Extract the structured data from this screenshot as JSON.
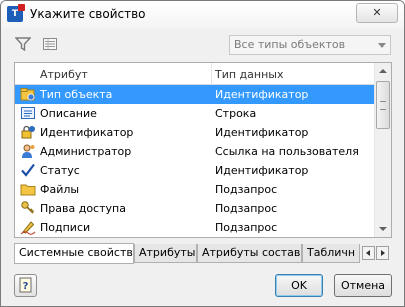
{
  "window": {
    "title": "Укажите свойство",
    "close_label": "✕"
  },
  "toolbar": {
    "filter_icon": "funnel-icon",
    "list_icon": "list-view-icon",
    "type_filter_value": "Все типы объектов"
  },
  "list": {
    "columns": [
      "Атрибут",
      "Тип данных"
    ],
    "rows": [
      {
        "icon": "object-type-icon",
        "attribute": "Тип объекта",
        "data_type": "Идентификатор",
        "selected": true
      },
      {
        "icon": "description-icon",
        "attribute": "Описание",
        "data_type": "Строка"
      },
      {
        "icon": "identifier-icon",
        "attribute": "Идентификатор",
        "data_type": "Идентификатор"
      },
      {
        "icon": "administrator-icon",
        "attribute": "Администратор",
        "data_type": "Ссылка на пользователя"
      },
      {
        "icon": "status-check-icon",
        "attribute": "Статус",
        "data_type": "Идентификатор"
      },
      {
        "icon": "files-folder-icon",
        "attribute": "Файлы",
        "data_type": "Подзапрос"
      },
      {
        "icon": "keys-icon",
        "attribute": "Права доступа",
        "data_type": "Подзапрос"
      },
      {
        "icon": "signature-pen-icon",
        "attribute": "Подписи",
        "data_type": "Подзапрос"
      }
    ]
  },
  "tabs": [
    {
      "label": "Системные свойства",
      "active": true
    },
    {
      "label": "Атрибуты"
    },
    {
      "label": "Атрибуты состава"
    },
    {
      "label": "Табличн"
    }
  ],
  "buttons": {
    "help_label": "?",
    "ok_label": "OK",
    "cancel_label": "Отмена"
  },
  "colors": {
    "selection": "#3399ff",
    "ok_border": "#3c7fb1"
  }
}
